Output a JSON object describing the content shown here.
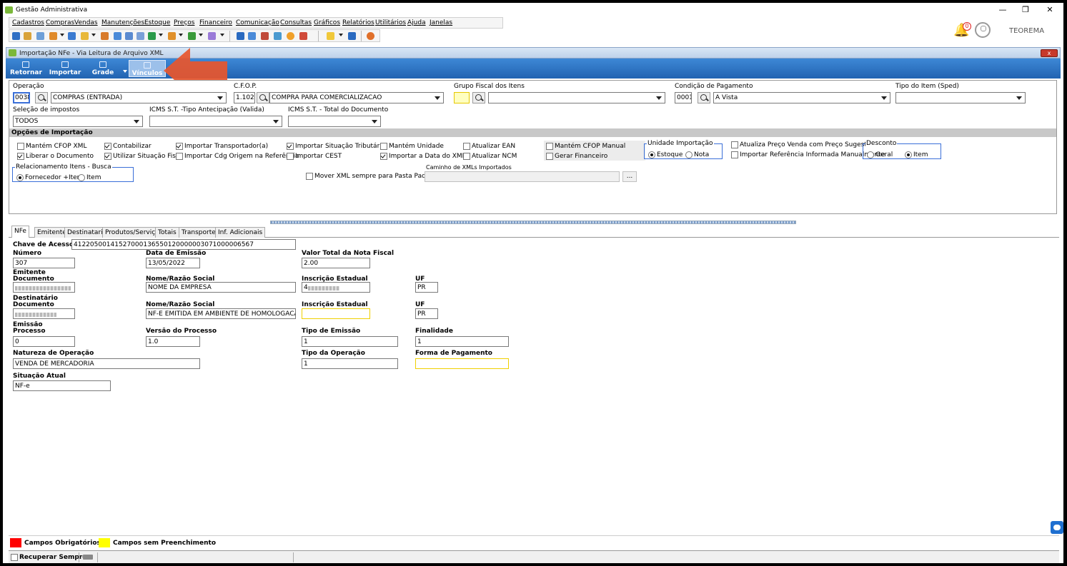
{
  "app": {
    "title": "Gestão Administrativa",
    "user": "TEOREMA",
    "notifications": "0"
  },
  "menu": [
    "Cadastros",
    "Compras",
    "Vendas",
    "Manutenções",
    "Estoque",
    "Preços",
    "Financeiro",
    "Comunicação",
    "Consultas",
    "Gráficos",
    "Relatórios",
    "Utilitários",
    "Ajuda",
    "Janelas"
  ],
  "window": {
    "title": "Importação NFe - Via Leitura de Arquivo XML",
    "close_label": "x"
  },
  "ribbon": {
    "retornar": "Retornar",
    "importar": "Importar",
    "grade": "Grade",
    "vinculos": "Vínculos"
  },
  "form": {
    "operacao_label": "Operação",
    "operacao_code": "0038",
    "operacao_desc": "COMPRAS (ENTRADA)",
    "cfop_label": "C.F.O.P.",
    "cfop_code": "1.102",
    "cfop_desc": "COMPRA PARA COMERCIALIZACAO",
    "grupo_fiscal_label": "Grupo Fiscal dos Itens",
    "condicao_label": "Condição de Pagamento",
    "condicao_code": "0001",
    "condicao_desc": "A Vista",
    "tipo_item_label": "Tipo do Item (Sped)",
    "selecao_impostos_label": "Seleção de impostos",
    "selecao_impostos_value": "TODOS",
    "icms_antecipacao_label": "ICMS S.T. -Tipo Antecipação (Valida)",
    "icms_total_label": "ICMS S.T. - Total do Documento"
  },
  "opcoes": {
    "title": "Opções de Importação",
    "mantem_cfop_xml": "Mantém CFOP XML",
    "liberar_documento": "Liberar o Documento",
    "contabilizar": "Contabilizar",
    "utilizar_situacao": "Utilizar Situação Fisca",
    "importar_transportador": "Importar Transportador(a)",
    "importar_cdg_origem": "Importar Cdg Origem na Referência",
    "importar_situacao_trib": "Importar Situação Tributária",
    "importar_cest": "Importar CEST",
    "mantem_unidade": "Mantém Unidade",
    "importar_data_xml": "Importar a Data do XML",
    "atualizar_ean": "Atualizar EAN",
    "atualizar_ncm": "Atualizar NCM",
    "mantem_cfop_manual": "Mantém CFOP Manual",
    "gerar_financeiro": "Gerar Financeiro",
    "unidade_importacao": "Unidade Importação",
    "estoque": "Estoque",
    "nota": "Nota",
    "atualiza_preco": "Atualiza Preço Venda com Preço Sugestão",
    "importar_referencia": "Importar Referência Informada Manualmente",
    "desconto": "Desconto",
    "geral": "Geral",
    "item": "Item",
    "relacionamento": "Relacionamento Itens - Busca",
    "fornecedor_item": "Fornecedor +Item",
    "rel_item": "Item",
    "mover_xml": "Mover XML sempre para Pasta Padrão",
    "caminho_xml": "Caminho de XMLs Importados",
    "browse": "..."
  },
  "tabs": [
    "NFe",
    "Emitente",
    "Destinatario",
    "Produtos/Serviços",
    "Totais",
    "Transporte",
    "Inf. Adicionais"
  ],
  "nfe": {
    "chave_label": "Chave de Acesso",
    "chave_value": "41220500141527000136550120000003071000006567",
    "numero_label": "Número",
    "numero_value": "307",
    "data_emissao_label": "Data de Emissão",
    "data_emissao_value": "13/05/2022",
    "valor_total_label": "Valor Total da Nota Fiscal",
    "valor_total_value": "2.00",
    "emitente_label": "Emitente",
    "documento_label": "Documento",
    "nome_label": "Nome/Razão Social",
    "emit_nome": "NOME DA EMPRESA",
    "ie_label": "Inscrição Estadual",
    "emit_ie_prefix": "4",
    "uf_label": "UF",
    "emit_uf": "PR",
    "destinatario_label": "Destinatário",
    "dest_documento_label": "Documento",
    "dest_nome_label": "Nome/Razão Social",
    "dest_nome": "NF-E EMITIDA EM AMBIENTE DE HOMOLOGACAO - SI",
    "dest_ie_label": "Inscrição Estadual",
    "dest_uf_label": "UF",
    "dest_uf": "PR",
    "emissao_label": "Emissão",
    "processo_label": "Processo",
    "processo_value": "0",
    "versao_label": "Versão do Processo",
    "versao_value": "1.0",
    "tipo_emissao_label": "Tipo de Emissão",
    "tipo_emissao_value": "1",
    "finalidade_label": "Finalidade",
    "finalidade_value": "1",
    "natureza_label": "Natureza de Operação",
    "natureza_value": "VENDA DE MERCADORIA",
    "tipo_operacao_label": "Tipo da Operação",
    "tipo_operacao_value": "1",
    "forma_pagamento_label": "Forma de Pagamento",
    "situacao_label": "Situação Atual",
    "situacao_value": "NF-e"
  },
  "legend": {
    "obrigatorios": "Campos Obrigatórios",
    "sem_preenchimento": "Campos sem Preenchimento",
    "red": "#ff0000",
    "yellow": "#ffff00"
  },
  "status": {
    "recuperar": "Recuperar Sempre"
  }
}
